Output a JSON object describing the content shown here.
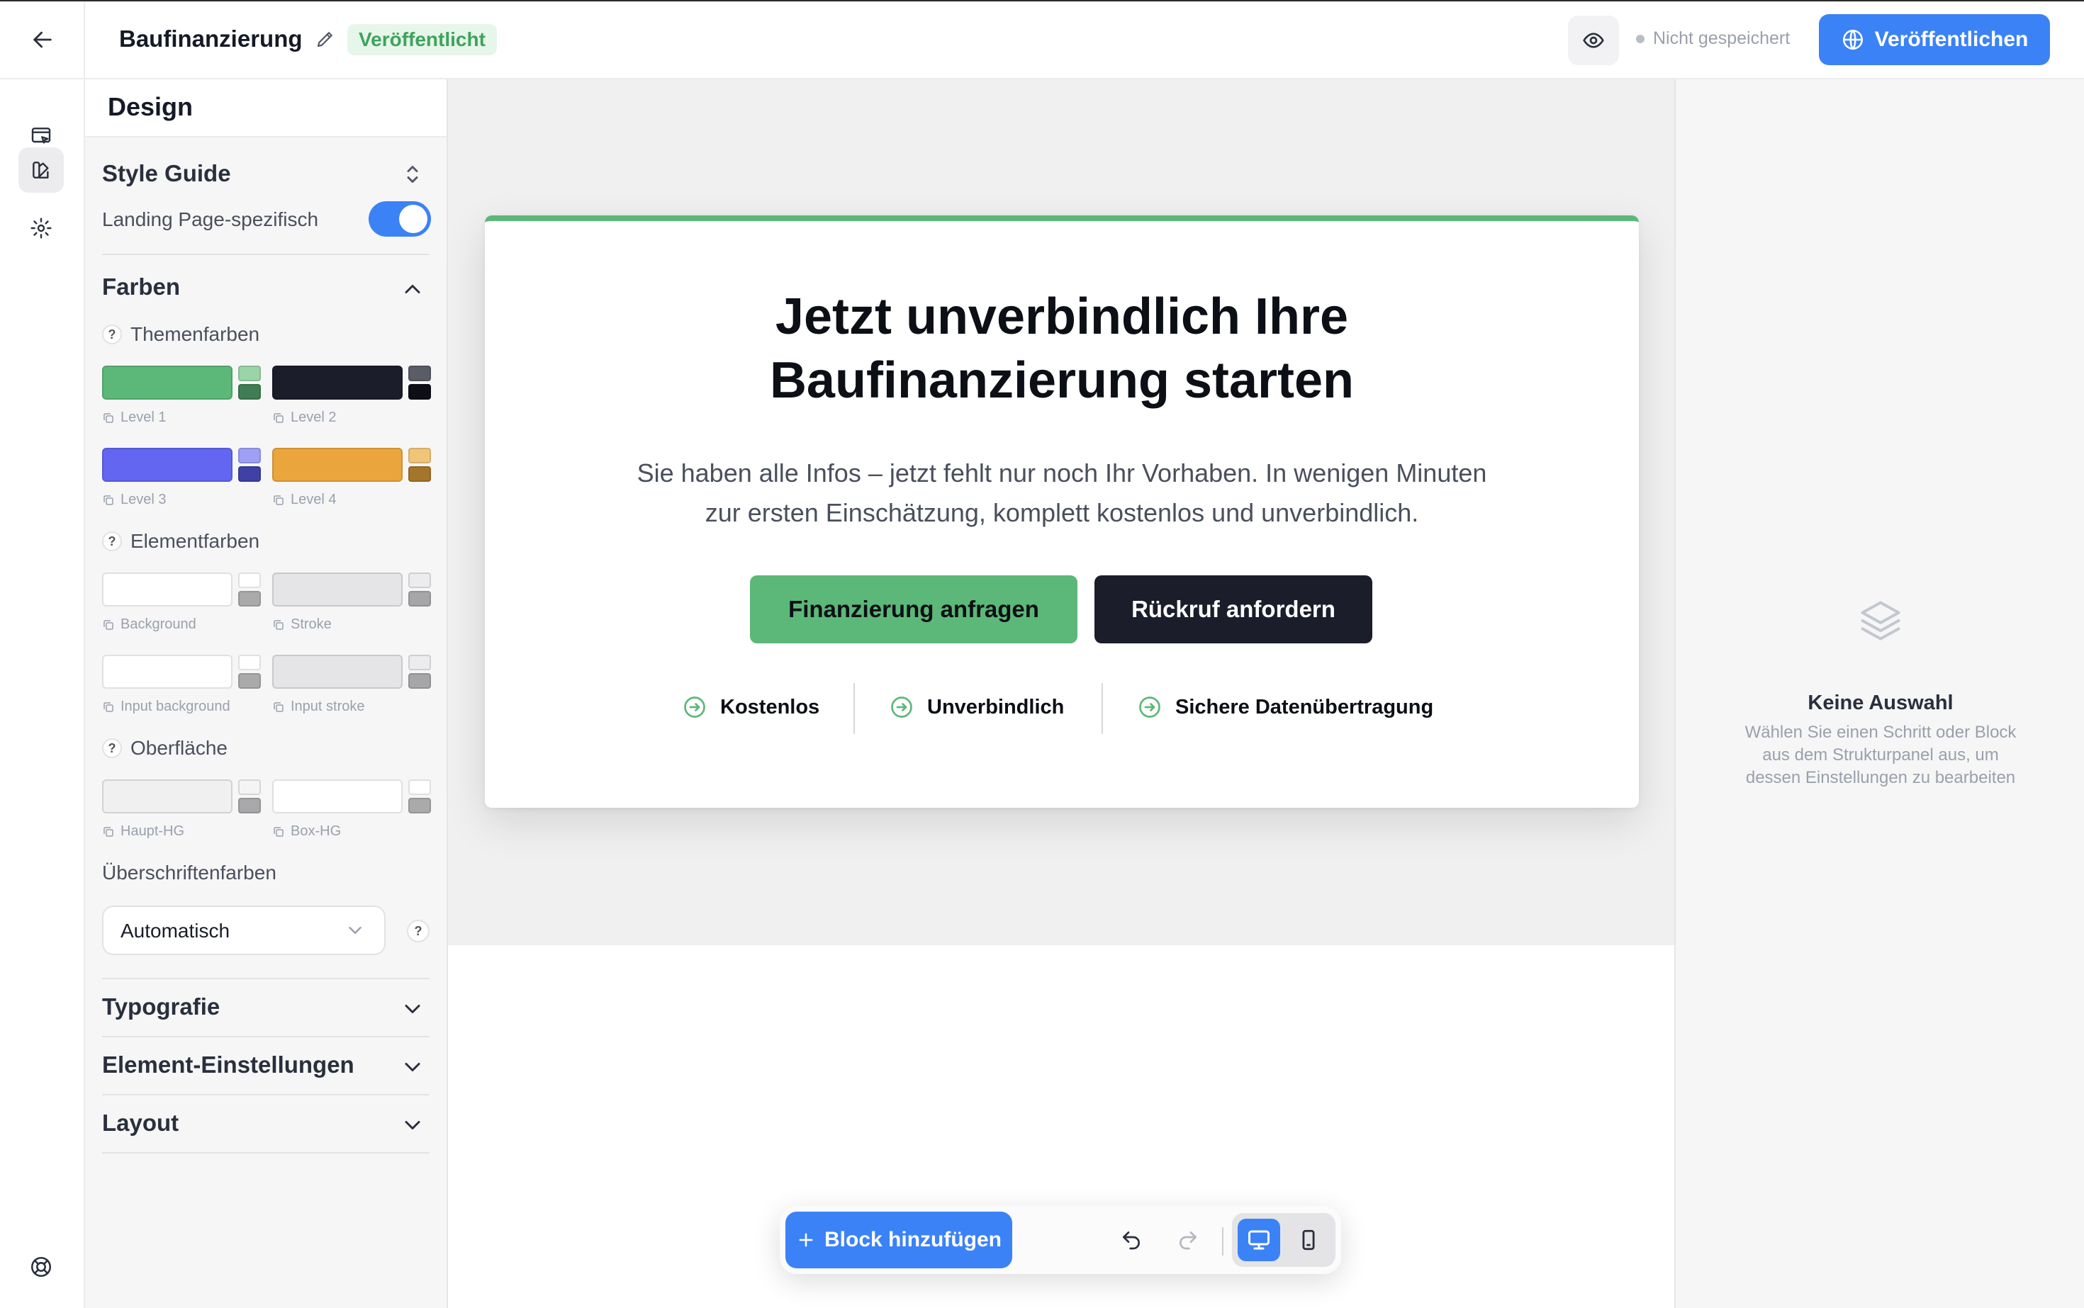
{
  "topbar": {
    "title": "Baufinanzierung",
    "badge": "Veröffentlicht",
    "save_status": "Nicht gespeichert",
    "publish_label": "Veröffentlichen"
  },
  "panel": {
    "title": "Design",
    "style_guide": {
      "title": "Style Guide",
      "toggle_label": "Landing Page-spezifisch",
      "toggle_on": true
    },
    "farben": {
      "title": "Farben",
      "themenfarben": {
        "title": "Themenfarben",
        "help": "?",
        "swatches": [
          {
            "label": "Level 1",
            "main": "#5cb878",
            "light": "#9ad4a8",
            "dark": "#3f7e52"
          },
          {
            "label": "Level 2",
            "main": "#1b1d2a",
            "light": "#5a5c66",
            "dark": "#0e0f16"
          },
          {
            "label": "Level 3",
            "main": "#6366f1",
            "light": "#9ea0f5",
            "dark": "#3f41a6"
          },
          {
            "label": "Level 4",
            "main": "#eaa53c",
            "light": "#f1c579",
            "dark": "#a6752a"
          }
        ]
      },
      "elementfarben": {
        "title": "Elementfarben",
        "help": "?",
        "swatches": [
          {
            "label": "Background",
            "main": "#ffffff",
            "light": "#ffffff",
            "dark": "#aaaaaa"
          },
          {
            "label": "Stroke",
            "main": "#e5e5e8",
            "light": "#ececee",
            "dark": "#a6a6a8"
          },
          {
            "label": "Input background",
            "main": "#ffffff",
            "light": "#ffffff",
            "dark": "#aaaaaa"
          },
          {
            "label": "Input stroke",
            "main": "#e5e5e8",
            "light": "#ececee",
            "dark": "#a6a6a8"
          }
        ]
      },
      "oberflaeche": {
        "title": "Oberfläche",
        "help": "?",
        "swatches": [
          {
            "label": "Haupt-HG",
            "main": "#f0f0f1",
            "light": "#f4f4f5",
            "dark": "#a8a8aa"
          },
          {
            "label": "Box-HG",
            "main": "#ffffff",
            "light": "#ffffff",
            "dark": "#aaaaaa"
          }
        ]
      },
      "ueberschriftenfarben": {
        "title": "Überschriftenfarben",
        "value": "Automatisch",
        "help": "?"
      }
    },
    "sections": [
      {
        "title": "Typografie"
      },
      {
        "title": "Element-Einstellungen"
      },
      {
        "title": "Layout"
      }
    ]
  },
  "card": {
    "headline_lines": [
      "Jetzt unverbindlich Ihre",
      "Baufinanzierung starten"
    ],
    "subtext_lines": [
      "Sie haben alle Infos – jetzt fehlt nur noch Ihr Vorhaben. In wenigen Minuten",
      "zur ersten Einschätzung, komplett kostenlos und unverbindlich."
    ],
    "cta_primary": "Finanzierung anfragen",
    "cta_secondary": "Rückruf anfordern",
    "trust": [
      "Kostenlos",
      "Unverbindlich",
      "Sichere Datenübertragung"
    ]
  },
  "toolbar": {
    "add_block": "Block hinzufügen"
  },
  "right_panel": {
    "title": "Keine Auswahl",
    "description": "Wählen Sie einen Schritt oder Block aus dem Strukturpanel aus, um dessen Einstellungen zu bearbeiten"
  },
  "colors": {
    "accent": "#3b82f6",
    "brand_green": "#5cb878",
    "dark": "#1b1d2a"
  }
}
